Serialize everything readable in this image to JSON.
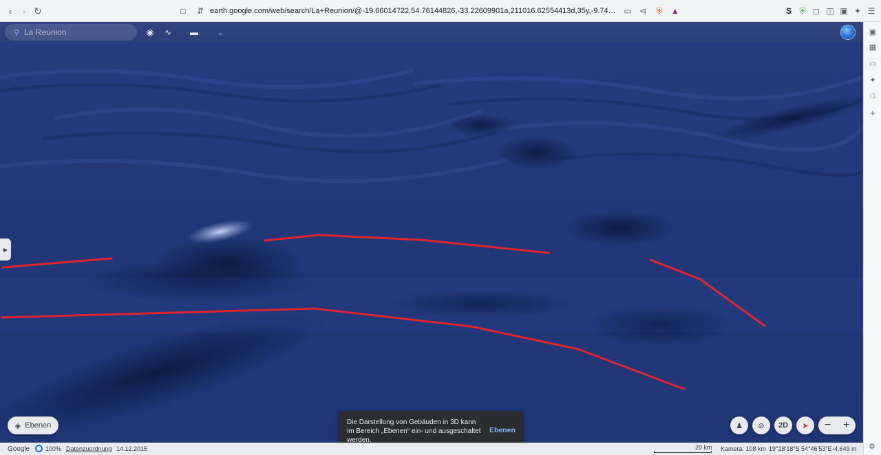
{
  "browser": {
    "url": "earth.google.com/web/search/La+Reunion/@-19.66014722,54.76144826,-33.22609901a,211016.62554413d,35y,-9.745616h,59.87761331..."
  },
  "earth": {
    "search_placeholder": "La Reunion",
    "layers_label": "Ebenen",
    "mode_2d_label": "2D",
    "toast": {
      "message": "Die Darstellung von Gebäuden in 3D kann im Bereich „Ebenen“ ein- und ausgeschaltet werden.",
      "action": "Ebenen"
    },
    "status": {
      "brand": "Google",
      "progress": "100%",
      "attribution": "Datenzuordnung",
      "date": "14.12.2015",
      "scale": "20 km",
      "camera": "Kamera: 108 km",
      "coords": "19°28'18\"S 54°46'53\"E",
      "elevation": "-4.649 m"
    },
    "colors": {
      "ocean": "#1f3576",
      "annotation": "#e0242e",
      "accent": "#8ab4f8"
    }
  }
}
